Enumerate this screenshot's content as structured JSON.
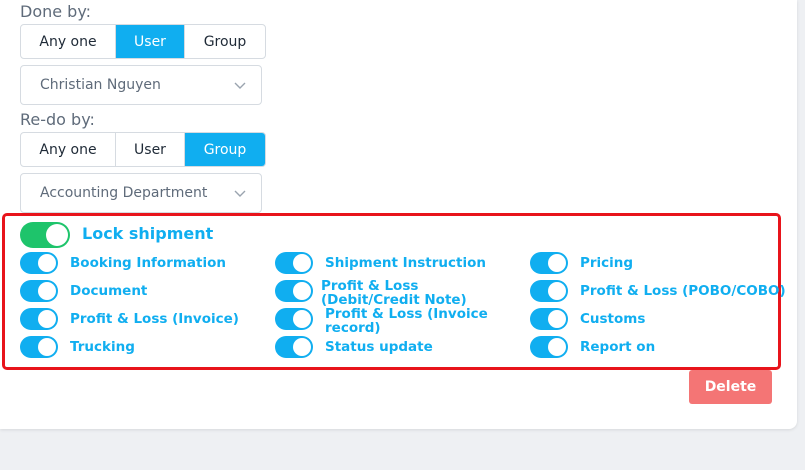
{
  "done_by": {
    "label": "Done by:",
    "options": [
      "Any one",
      "User",
      "Group"
    ],
    "selected": "User",
    "value": "Christian Nguyen"
  },
  "redo_by": {
    "label": "Re-do by:",
    "options": [
      "Any one",
      "User",
      "Group"
    ],
    "selected": "Group",
    "value": "Accounting Department"
  },
  "lock": {
    "label": "Lock shipment",
    "enabled": true,
    "toggle_color": "#1ec46b"
  },
  "permissions": [
    {
      "label": "Booking Information",
      "enabled": true
    },
    {
      "label": "Shipment Instruction",
      "enabled": true
    },
    {
      "label": "Pricing",
      "enabled": true
    },
    {
      "label": "Document",
      "enabled": true
    },
    {
      "label": "Profit & Loss (Debit/Credit Note)",
      "enabled": true
    },
    {
      "label": "Profit & Loss (POBO/COBO)",
      "enabled": true
    },
    {
      "label": "Profit & Loss (Invoice)",
      "enabled": true
    },
    {
      "label": "Profit & Loss (Invoice record)",
      "enabled": true
    },
    {
      "label": "Customs",
      "enabled": true
    },
    {
      "label": "Trucking",
      "enabled": true
    },
    {
      "label": "Status update",
      "enabled": true
    },
    {
      "label": "Report on",
      "enabled": true
    }
  ],
  "actions": {
    "delete_label": "Delete"
  },
  "colors": {
    "accent": "#10aef0",
    "danger_border": "#e8141b",
    "delete_bg": "#f47575"
  }
}
